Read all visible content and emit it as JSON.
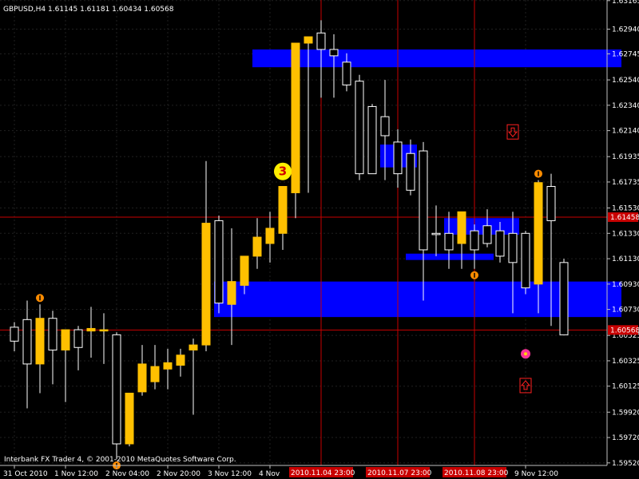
{
  "chart_title": "GBPUSD,H4  1.61145 1.61181 1.60434 1.60568",
  "footer": "Interbank FX Trader 4, © 2001-2010 MetaQuotes Software Corp.",
  "colors": {
    "background": "#000000",
    "grid": "#202020",
    "bull_candle": "#ffc000",
    "bear_candle": "#000000",
    "candle_outline": "#ffffff",
    "zone": "#0000ff",
    "red_line": "#c80000",
    "fractal": "#ff8c00",
    "signal": "#ff3399",
    "label_bg": "#c80000"
  },
  "chart_data": {
    "type": "candlestick",
    "symbol": "GBPUSD",
    "timeframe": "H4",
    "ylim": [
      1.595,
      1.6317
    ],
    "y_ticks": [
      "1.63165",
      "1.62940",
      "1.62745",
      "1.62540",
      "1.62340",
      "1.62140",
      "1.61935",
      "1.61735",
      "1.61530",
      "1.61330",
      "1.61130",
      "1.60930",
      "1.60730",
      "1.60525",
      "1.60325",
      "1.60125",
      "1.59920",
      "1.59720",
      "1.59520"
    ],
    "x_ticks": [
      {
        "label": "31 Oct 2010",
        "bar": 0
      },
      {
        "label": "1 Nov 12:00",
        "bar": 4
      },
      {
        "label": "2 Nov 04:00",
        "bar": 8
      },
      {
        "label": "2 Nov 20:00",
        "bar": 12
      },
      {
        "label": "3 Nov 12:00",
        "bar": 16
      },
      {
        "label": "4 Nov",
        "bar": 20
      },
      {
        "label": "9 Nov 12:00",
        "bar": 40
      }
    ],
    "candles": [
      {
        "o": 1.6059,
        "h": 1.6063,
        "l": 1.604,
        "c": 1.6048
      },
      {
        "o": 1.6065,
        "h": 1.608,
        "l": 1.5995,
        "c": 1.603
      },
      {
        "o": 1.603,
        "h": 1.6077,
        "l": 1.6007,
        "c": 1.6066
      },
      {
        "o": 1.6066,
        "h": 1.6072,
        "l": 1.6014,
        "c": 1.6041
      },
      {
        "o": 1.6041,
        "h": 1.6052,
        "l": 1.6,
        "c": 1.6057
      },
      {
        "o": 1.6057,
        "h": 1.606,
        "l": 1.6025,
        "c": 1.6043
      },
      {
        "o": 1.6056,
        "h": 1.6075,
        "l": 1.6035,
        "c": 1.6058
      },
      {
        "o": 1.6056,
        "h": 1.607,
        "l": 1.603,
        "c": 1.6057
      },
      {
        "o": 1.6053,
        "h": 1.6055,
        "l": 1.5955,
        "c": 1.5967
      },
      {
        "o": 1.5967,
        "h": 1.6005,
        "l": 1.5965,
        "c": 1.6007
      },
      {
        "o": 1.6008,
        "h": 1.6045,
        "l": 1.6005,
        "c": 1.603
      },
      {
        "o": 1.6016,
        "h": 1.6045,
        "l": 1.601,
        "c": 1.6028
      },
      {
        "o": 1.6026,
        "h": 1.6042,
        "l": 1.601,
        "c": 1.6031
      },
      {
        "o": 1.6029,
        "h": 1.6042,
        "l": 1.602,
        "c": 1.6037
      },
      {
        "o": 1.6041,
        "h": 1.605,
        "l": 1.599,
        "c": 1.6045
      },
      {
        "o": 1.6045,
        "h": 1.619,
        "l": 1.604,
        "c": 1.6141
      },
      {
        "o": 1.6143,
        "h": 1.6147,
        "l": 1.607,
        "c": 1.6078
      },
      {
        "o": 1.6077,
        "h": 1.6137,
        "l": 1.6045,
        "c": 1.6095
      },
      {
        "o": 1.6092,
        "h": 1.6113,
        "l": 1.6085,
        "c": 1.6115
      },
      {
        "o": 1.6115,
        "h": 1.6145,
        "l": 1.6105,
        "c": 1.613
      },
      {
        "o": 1.6125,
        "h": 1.615,
        "l": 1.611,
        "c": 1.6137
      },
      {
        "o": 1.6133,
        "h": 1.6168,
        "l": 1.612,
        "c": 1.617
      },
      {
        "o": 1.6165,
        "h": 1.6225,
        "l": 1.6145,
        "c": 1.6283
      },
      {
        "o": 1.6283,
        "h": 1.6287,
        "l": 1.6165,
        "c": 1.6288
      },
      {
        "o": 1.6291,
        "h": 1.6301,
        "l": 1.624,
        "c": 1.6278
      },
      {
        "o": 1.6278,
        "h": 1.629,
        "l": 1.624,
        "c": 1.6273
      },
      {
        "o": 1.6268,
        "h": 1.6275,
        "l": 1.6245,
        "c": 1.625
      },
      {
        "o": 1.6253,
        "h": 1.6258,
        "l": 1.6175,
        "c": 1.618
      },
      {
        "o": 1.6233,
        "h": 1.6235,
        "l": 1.618,
        "c": 1.618
      },
      {
        "o": 1.6225,
        "h": 1.6254,
        "l": 1.6175,
        "c": 1.621
      },
      {
        "o": 1.6205,
        "h": 1.6215,
        "l": 1.6169,
        "c": 1.618
      },
      {
        "o": 1.6196,
        "h": 1.6207,
        "l": 1.6163,
        "c": 1.6167
      },
      {
        "o": 1.6198,
        "h": 1.6205,
        "l": 1.608,
        "c": 1.612
      },
      {
        "o": 1.6133,
        "h": 1.6155,
        "l": 1.6115,
        "c": 1.6132
      },
      {
        "o": 1.6133,
        "h": 1.615,
        "l": 1.6105,
        "c": 1.612
      },
      {
        "o": 1.6125,
        "h": 1.615,
        "l": 1.6105,
        "c": 1.615
      },
      {
        "o": 1.6135,
        "h": 1.614,
        "l": 1.6105,
        "c": 1.612
      },
      {
        "o": 1.6139,
        "h": 1.6152,
        "l": 1.6122,
        "c": 1.6125
      },
      {
        "o": 1.6135,
        "h": 1.6142,
        "l": 1.611,
        "c": 1.6115
      },
      {
        "o": 1.6133,
        "h": 1.615,
        "l": 1.607,
        "c": 1.611
      },
      {
        "o": 1.6133,
        "h": 1.6135,
        "l": 1.6085,
        "c": 1.609
      },
      {
        "o": 1.6093,
        "h": 1.6175,
        "l": 1.607,
        "c": 1.6173
      },
      {
        "o": 1.617,
        "h": 1.618,
        "l": 1.606,
        "c": 1.6143
      },
      {
        "o": 1.611,
        "h": 1.6113,
        "l": 1.6055,
        "c": 1.6053
      }
    ],
    "zones": [
      {
        "from_bar": 19,
        "to_bar": 47,
        "top": 1.6278,
        "bottom": 1.6264
      },
      {
        "from_bar": 29,
        "to_bar": 31,
        "top": 1.6203,
        "bottom": 1.6185
      },
      {
        "from_bar": 31,
        "to_bar": 37,
        "top": 1.6117,
        "bottom": 1.6112
      },
      {
        "from_bar": 34,
        "to_bar": 39,
        "top": 1.6145,
        "bottom": 1.6132
      },
      {
        "from_bar": 16,
        "to_bar": 47,
        "top": 1.6095,
        "bottom": 1.6067
      }
    ],
    "hlines": [
      1.61458,
      1.60568
    ],
    "vlines_bar": [
      24,
      30,
      36
    ],
    "red_labels_y": [
      "1.61458",
      "1.60568"
    ],
    "red_labels_x": [
      "2010.11.04 23:00",
      "2010.11.07 23:00",
      "2010.11.08 23:00"
    ],
    "fractals_up": [
      2,
      41
    ],
    "fractals_down": [
      8,
      36
    ],
    "signal_point": {
      "bar": 40,
      "value": 1.6038
    },
    "annotation_number": "3",
    "annotation_bar": 21,
    "arrow_down_bar": 39,
    "arrow_down_value": 1.6213,
    "arrow_up_bar": 40,
    "arrow_up_value": 1.6013
  }
}
